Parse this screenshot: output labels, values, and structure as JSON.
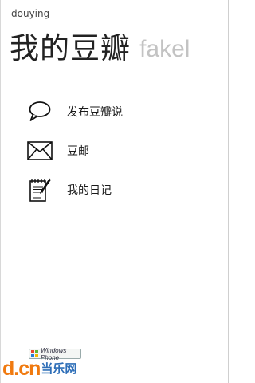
{
  "app": {
    "name": "douying"
  },
  "pivot": {
    "current": "我的豆瓣",
    "next": "fakel"
  },
  "menu": {
    "items": [
      {
        "label": "发布豆瓣说",
        "icon": "speech-bubble-icon"
      },
      {
        "label": "豆邮",
        "icon": "envelope-icon"
      },
      {
        "label": "我的日记",
        "icon": "diary-icon"
      }
    ]
  },
  "badge": {
    "text": "Windows Phone",
    "colors": [
      "#e8452c",
      "#5fb335",
      "#2b7bd3",
      "#f5b800"
    ]
  },
  "watermark": {
    "logo": "d.cn",
    "site": "当乐网",
    "logo_color": "#f07a10",
    "site_color": "#2f6fb8"
  }
}
